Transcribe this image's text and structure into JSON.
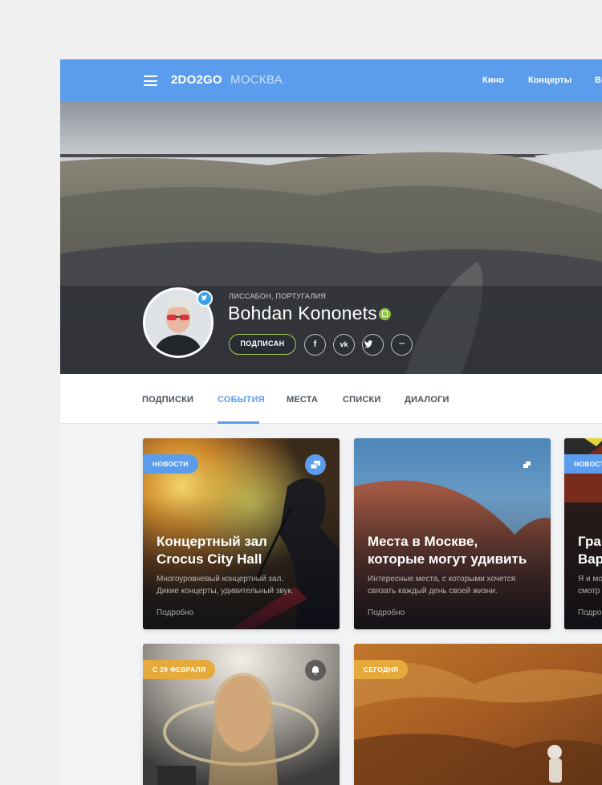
{
  "header": {
    "brand": "2DO2GO",
    "city": "МОСКВА",
    "nav": [
      "Кино",
      "Концерты",
      "Вы"
    ]
  },
  "profile": {
    "location": "ЛИССАБОН, ПОРТУГАЛИЯ",
    "name": "Bohdan Kononets",
    "subscribe_label": "ПОДПИСАН",
    "social": [
      "f",
      "vk",
      "tw",
      "···"
    ]
  },
  "tabs": [
    "ПОДПИСКИ",
    "СОБЫТИЯ",
    "МЕСТА",
    "СПИСКИ",
    "ДИАЛОГИ"
  ],
  "active_tab": "СОБЫТИЯ",
  "cards": [
    {
      "tag": "НОВОСТИ",
      "title_line1": "Концертный зал",
      "title_line2": "Crocus City Hall",
      "desc_line1": "Многоуровневый концертный зал.",
      "desc_line2": "Дикие концерты, удивительный звук.",
      "more": "Подробно"
    },
    {
      "title_line1": "Места в Москве,",
      "title_line2": "которые могут удивить",
      "desc_line1": "Интересные места, с которыми хочется",
      "desc_line2": "связать каждый день своей жизни.",
      "more": "Подробно"
    },
    {
      "tag": "НОВОСТ",
      "title_line1": "Гра",
      "title_line2": "Вар",
      "desc_line1": "Я и мо",
      "desc_line2": "смотр",
      "more": "Подро"
    },
    {
      "tag": "С 29 ФЕВРАЛЯ"
    },
    {
      "tag": "СЕГОДНЯ"
    }
  ],
  "colors": {
    "primary": "#5b9cec",
    "tag_orange": "#e6a93b",
    "verified": "#8cc63f",
    "subscribe_border": "#a4cf4a"
  },
  "icons": [
    "menu-icon",
    "twitter-icon",
    "verified-icon",
    "facebook-icon",
    "vk-icon",
    "twitter-icon",
    "more-icon",
    "gallery-icon",
    "bell-icon"
  ]
}
